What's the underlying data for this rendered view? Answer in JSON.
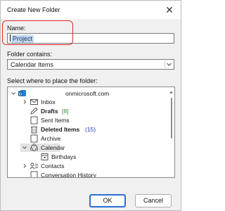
{
  "dialog": {
    "title": "Create New Folder",
    "close_glyph": "✕"
  },
  "name_field": {
    "label": "Name:",
    "value": "Project"
  },
  "contains_field": {
    "label": "Folder contains:",
    "value": "Calendar Items"
  },
  "tree_section": {
    "label": "Select where to place the folder:",
    "items": [
      {
        "label": "onmicrosoft.com",
        "icon": "outlook-account-icon",
        "count": ""
      },
      {
        "label": "Inbox",
        "icon": "inbox-icon",
        "count": ""
      },
      {
        "label": "Drafts",
        "icon": "drafts-icon",
        "count": "[8]"
      },
      {
        "label": "Sent Items",
        "icon": "sent-items-icon",
        "count": ""
      },
      {
        "label": "Deleted Items",
        "icon": "trash-icon",
        "count": "(15)"
      },
      {
        "label": "Archive",
        "icon": "archive-icon",
        "count": ""
      },
      {
        "label": "Calendar",
        "icon": "calendar-icon",
        "count": ""
      },
      {
        "label": "Birthdays",
        "icon": "calendar-icon",
        "count": ""
      },
      {
        "label": "Contacts",
        "icon": "contacts-icon",
        "count": ""
      },
      {
        "label": "Conversation History",
        "icon": "folder-icon",
        "count": ""
      }
    ]
  },
  "buttons": {
    "ok": "OK",
    "cancel": "Cancel"
  },
  "colors": {
    "accent": "#2a6fd6",
    "highlight_border": "#e02a2a",
    "selection": "#c6d8f0"
  }
}
